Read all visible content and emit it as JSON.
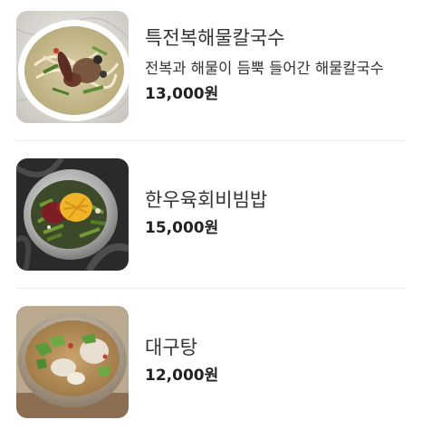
{
  "menu": {
    "items": [
      {
        "name": "특전복해물칼국수",
        "description": "전복과 해물이 듬뿍 들어간 해물칼국수",
        "price": "13,000원",
        "image_icon": "abalone-seafood-noodle-soup-photo"
      },
      {
        "name": "한우육회비빔밥",
        "price": "15,000원",
        "image_icon": "beef-tartare-bibimbap-photo"
      },
      {
        "name": "대구탕",
        "price": "12,000원",
        "image_icon": "cod-soup-photo"
      }
    ]
  },
  "colors": {
    "text": "#333333",
    "price": "#222222",
    "divider": "#eeeeee"
  }
}
